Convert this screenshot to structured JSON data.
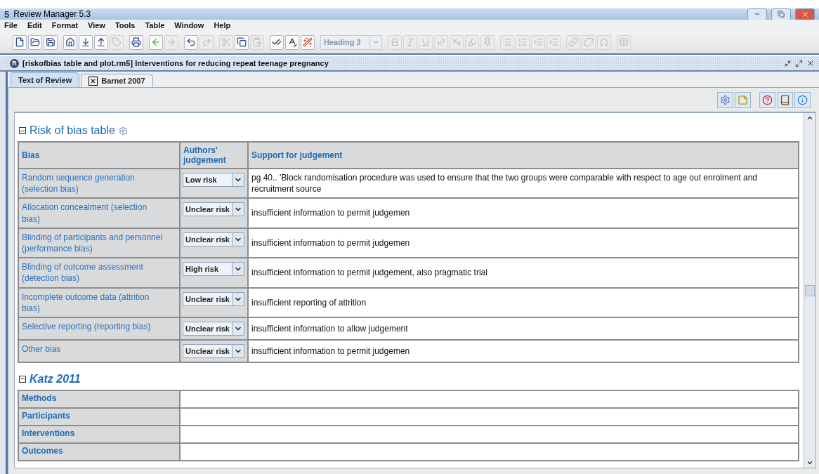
{
  "window": {
    "logo": "5",
    "title": "Review Manager 5.3"
  },
  "menu": [
    "File",
    "Edit",
    "Format",
    "View",
    "Tools",
    "Table",
    "Window",
    "Help"
  ],
  "toolbar": [
    {
      "kind": "buttons",
      "buttons": [
        {
          "kind": "new",
          "disabled": false
        },
        {
          "kind": "open",
          "disabled": false
        },
        {
          "kind": "save",
          "disabled": false
        }
      ]
    },
    {
      "kind": "buttons",
      "buttons": [
        {
          "kind": "home",
          "disabled": false
        },
        {
          "kind": "import",
          "disabled": false
        },
        {
          "kind": "export",
          "disabled": false
        },
        {
          "kind": "tag",
          "disabled": true
        }
      ]
    },
    {
      "kind": "buttons",
      "buttons": [
        {
          "kind": "print",
          "disabled": false
        }
      ]
    },
    {
      "kind": "buttons",
      "buttons": [
        {
          "kind": "back",
          "disabled": false
        },
        {
          "kind": "forward",
          "disabled": true
        }
      ]
    },
    {
      "kind": "buttons",
      "buttons": [
        {
          "kind": "undo",
          "disabled": false
        },
        {
          "kind": "redo",
          "disabled": true
        }
      ]
    },
    {
      "kind": "buttons",
      "buttons": [
        {
          "kind": "cut",
          "disabled": true
        },
        {
          "kind": "copy",
          "disabled": false
        },
        {
          "kind": "paste",
          "disabled": true
        }
      ]
    },
    {
      "kind": "buttons",
      "buttons": [
        {
          "kind": "check",
          "disabled": false
        },
        {
          "kind": "spell",
          "disabled": false
        },
        {
          "kind": "wand",
          "disabled": false
        }
      ]
    },
    {
      "kind": "select",
      "value": "Heading 3",
      "disabled": true
    },
    {
      "kind": "buttons",
      "buttons": [
        {
          "kind": "bold",
          "disabled": true
        },
        {
          "kind": "italic",
          "disabled": true
        },
        {
          "kind": "underline",
          "disabled": true
        },
        {
          "kind": "superscript",
          "disabled": true
        },
        {
          "kind": "subscript",
          "disabled": true
        },
        {
          "kind": "highlight",
          "disabled": true
        },
        {
          "kind": "pin",
          "disabled": true
        }
      ]
    },
    {
      "kind": "buttons",
      "buttons": [
        {
          "kind": "bullets",
          "disabled": true
        },
        {
          "kind": "numbers",
          "disabled": true
        },
        {
          "kind": "indent",
          "disabled": true
        },
        {
          "kind": "outdent",
          "disabled": true
        }
      ]
    },
    {
      "kind": "buttons",
      "buttons": [
        {
          "kind": "link",
          "disabled": true
        },
        {
          "kind": "unlink",
          "disabled": true
        },
        {
          "kind": "omega",
          "disabled": true
        }
      ]
    },
    {
      "kind": "buttons",
      "buttons": [
        {
          "kind": "table",
          "disabled": true
        }
      ]
    }
  ],
  "document": {
    "icon_letter": "R",
    "title": "[riskofbias table and plot.rm5] Interventions for reducing repeat teenage pregnancy"
  },
  "tabs": [
    {
      "label": "Text of Review",
      "selected": true,
      "closable": false
    },
    {
      "label": "Barnet 2007",
      "selected": false,
      "closable": true
    }
  ],
  "panel_tools": [
    {
      "kind": "properties"
    },
    {
      "kind": "note"
    },
    {
      "kind": "help"
    },
    {
      "kind": "book"
    },
    {
      "kind": "info"
    }
  ],
  "risk_table": {
    "title": "Risk of bias table",
    "columns": [
      "Bias",
      "Authors' judgement",
      "Support for judgement"
    ],
    "rows": [
      {
        "bias": "Random sequence generation (selection bias)",
        "judgement": "Low risk",
        "support": "pg 40.. 'Block randomisation procedure was used to ensure that the two groups were comparable with respect to age out enrolment and recruitment source"
      },
      {
        "bias": "Allocation concealment (selection bias)",
        "judgement": "Unclear risk",
        "support": "insufficient information to permit judgemen"
      },
      {
        "bias": "Blinding of participants and personnel (performance bias)",
        "judgement": "Unclear risk",
        "support": "insufficient information to permit judgemen"
      },
      {
        "bias": "Blinding of outcome assessment (detection bias)",
        "judgement": "High risk",
        "support": "insufficient information to permit judgement, also pragmatic trial"
      },
      {
        "bias": "Incomplete outcome data (attrition bias)",
        "judgement": "Unclear risk",
        "support": "insufficient reporting of attrition"
      },
      {
        "bias": "Selective reporting (reporting bias)",
        "judgement": "Unclear risk",
        "support": "insufficient information to allow judgement"
      },
      {
        "bias": "Other bias",
        "judgement": "Unclear risk",
        "support": "insufficient information to permit judgemen"
      }
    ]
  },
  "study": {
    "title": "Katz 2011",
    "rows": [
      {
        "label": "Methods"
      },
      {
        "label": "Participants"
      },
      {
        "label": "Interventions"
      },
      {
        "label": "Outcomes"
      }
    ]
  }
}
